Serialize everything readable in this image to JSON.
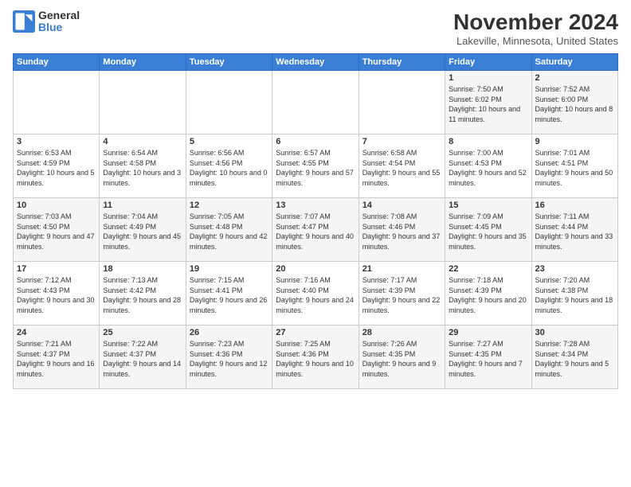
{
  "logo": {
    "general": "General",
    "blue": "Blue"
  },
  "header": {
    "month": "November 2024",
    "location": "Lakeville, Minnesota, United States"
  },
  "weekdays": [
    "Sunday",
    "Monday",
    "Tuesday",
    "Wednesday",
    "Thursday",
    "Friday",
    "Saturday"
  ],
  "weeks": [
    [
      {
        "day": "",
        "info": ""
      },
      {
        "day": "",
        "info": ""
      },
      {
        "day": "",
        "info": ""
      },
      {
        "day": "",
        "info": ""
      },
      {
        "day": "",
        "info": ""
      },
      {
        "day": "1",
        "info": "Sunrise: 7:50 AM\nSunset: 6:02 PM\nDaylight: 10 hours and 11 minutes."
      },
      {
        "day": "2",
        "info": "Sunrise: 7:52 AM\nSunset: 6:00 PM\nDaylight: 10 hours and 8 minutes."
      }
    ],
    [
      {
        "day": "3",
        "info": "Sunrise: 6:53 AM\nSunset: 4:59 PM\nDaylight: 10 hours and 5 minutes."
      },
      {
        "day": "4",
        "info": "Sunrise: 6:54 AM\nSunset: 4:58 PM\nDaylight: 10 hours and 3 minutes."
      },
      {
        "day": "5",
        "info": "Sunrise: 6:56 AM\nSunset: 4:56 PM\nDaylight: 10 hours and 0 minutes."
      },
      {
        "day": "6",
        "info": "Sunrise: 6:57 AM\nSunset: 4:55 PM\nDaylight: 9 hours and 57 minutes."
      },
      {
        "day": "7",
        "info": "Sunrise: 6:58 AM\nSunset: 4:54 PM\nDaylight: 9 hours and 55 minutes."
      },
      {
        "day": "8",
        "info": "Sunrise: 7:00 AM\nSunset: 4:53 PM\nDaylight: 9 hours and 52 minutes."
      },
      {
        "day": "9",
        "info": "Sunrise: 7:01 AM\nSunset: 4:51 PM\nDaylight: 9 hours and 50 minutes."
      }
    ],
    [
      {
        "day": "10",
        "info": "Sunrise: 7:03 AM\nSunset: 4:50 PM\nDaylight: 9 hours and 47 minutes."
      },
      {
        "day": "11",
        "info": "Sunrise: 7:04 AM\nSunset: 4:49 PM\nDaylight: 9 hours and 45 minutes."
      },
      {
        "day": "12",
        "info": "Sunrise: 7:05 AM\nSunset: 4:48 PM\nDaylight: 9 hours and 42 minutes."
      },
      {
        "day": "13",
        "info": "Sunrise: 7:07 AM\nSunset: 4:47 PM\nDaylight: 9 hours and 40 minutes."
      },
      {
        "day": "14",
        "info": "Sunrise: 7:08 AM\nSunset: 4:46 PM\nDaylight: 9 hours and 37 minutes."
      },
      {
        "day": "15",
        "info": "Sunrise: 7:09 AM\nSunset: 4:45 PM\nDaylight: 9 hours and 35 minutes."
      },
      {
        "day": "16",
        "info": "Sunrise: 7:11 AM\nSunset: 4:44 PM\nDaylight: 9 hours and 33 minutes."
      }
    ],
    [
      {
        "day": "17",
        "info": "Sunrise: 7:12 AM\nSunset: 4:43 PM\nDaylight: 9 hours and 30 minutes."
      },
      {
        "day": "18",
        "info": "Sunrise: 7:13 AM\nSunset: 4:42 PM\nDaylight: 9 hours and 28 minutes."
      },
      {
        "day": "19",
        "info": "Sunrise: 7:15 AM\nSunset: 4:41 PM\nDaylight: 9 hours and 26 minutes."
      },
      {
        "day": "20",
        "info": "Sunrise: 7:16 AM\nSunset: 4:40 PM\nDaylight: 9 hours and 24 minutes."
      },
      {
        "day": "21",
        "info": "Sunrise: 7:17 AM\nSunset: 4:39 PM\nDaylight: 9 hours and 22 minutes."
      },
      {
        "day": "22",
        "info": "Sunrise: 7:18 AM\nSunset: 4:39 PM\nDaylight: 9 hours and 20 minutes."
      },
      {
        "day": "23",
        "info": "Sunrise: 7:20 AM\nSunset: 4:38 PM\nDaylight: 9 hours and 18 minutes."
      }
    ],
    [
      {
        "day": "24",
        "info": "Sunrise: 7:21 AM\nSunset: 4:37 PM\nDaylight: 9 hours and 16 minutes."
      },
      {
        "day": "25",
        "info": "Sunrise: 7:22 AM\nSunset: 4:37 PM\nDaylight: 9 hours and 14 minutes."
      },
      {
        "day": "26",
        "info": "Sunrise: 7:23 AM\nSunset: 4:36 PM\nDaylight: 9 hours and 12 minutes."
      },
      {
        "day": "27",
        "info": "Sunrise: 7:25 AM\nSunset: 4:36 PM\nDaylight: 9 hours and 10 minutes."
      },
      {
        "day": "28",
        "info": "Sunrise: 7:26 AM\nSunset: 4:35 PM\nDaylight: 9 hours and 9 minutes."
      },
      {
        "day": "29",
        "info": "Sunrise: 7:27 AM\nSunset: 4:35 PM\nDaylight: 9 hours and 7 minutes."
      },
      {
        "day": "30",
        "info": "Sunrise: 7:28 AM\nSunset: 4:34 PM\nDaylight: 9 hours and 5 minutes."
      }
    ]
  ]
}
